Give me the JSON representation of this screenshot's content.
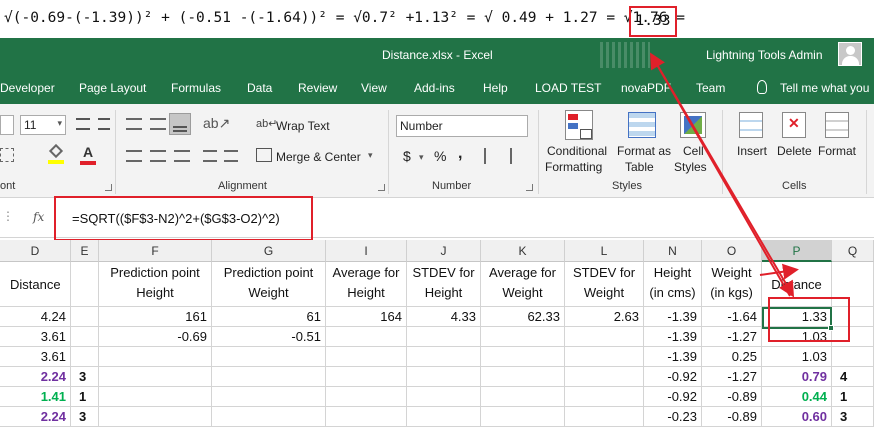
{
  "banner": {
    "expression": "√(-0.69-(-1.39))² + (-0.51 -(-1.64))² = √0.7² +1.13² = √ 0.49 + 1.27 = √1.76 = ",
    "result": "1.33"
  },
  "titlebar": {
    "document": "Distance.xlsx  -  Excel",
    "user": "Lightning Tools Admin"
  },
  "menu": {
    "tabs": [
      "Developer",
      "Page Layout",
      "Formulas",
      "Data",
      "Review",
      "View",
      "Add-ins",
      "Help",
      "LOAD TEST",
      "novaPDF",
      "Team"
    ],
    "tell_me": "Tell me what you"
  },
  "ribbon": {
    "font_size": "11",
    "font_group_label": "ont",
    "wrap_text": "Wrap Text",
    "merge_center": "Merge & Center",
    "alignment_label": "Alignment",
    "number_format": "Number",
    "number_label": "Number",
    "currency_symbol": "$",
    "percent_symbol": "%",
    "comma_symbol": ",",
    "conditional_formatting": [
      "Conditional",
      "Formatting"
    ],
    "format_as_table": [
      "Format as",
      "Table"
    ],
    "cell_styles": [
      "Cell",
      "Styles"
    ],
    "styles_label": "Styles",
    "insert": "Insert",
    "delete": "Delete",
    "format": "Format",
    "cells_label": "Cells"
  },
  "formula_bar": {
    "fx": "fx",
    "formula": "=SQRT(($F$3-N2)^2+($G$3-O2)^2)"
  },
  "columns": [
    "D",
    "E",
    "F",
    "G",
    "I",
    "J",
    "K",
    "L",
    "N",
    "O",
    "P",
    "Q"
  ],
  "header_row": {
    "D": "Distance",
    "F": [
      "Prediction point",
      "Height"
    ],
    "G": [
      "Prediction point",
      "Weight"
    ],
    "I": [
      "Average for",
      "Height"
    ],
    "J": [
      "STDEV for",
      "Height"
    ],
    "K": [
      "Average for",
      "Weight"
    ],
    "L": [
      "STDEV for",
      "Weight"
    ],
    "N": [
      "Height",
      "(in cms)"
    ],
    "O": [
      "Weight",
      "(in kgs)"
    ],
    "P": "Distance"
  },
  "rows": [
    {
      "D": "4.24",
      "E": "",
      "F": "161",
      "G": "61",
      "I": "164",
      "J": "4.33",
      "K": "62.33",
      "L": "2.63",
      "N": "-1.39",
      "O": "-1.64",
      "P": "1.33",
      "Q": ""
    },
    {
      "D": "3.61",
      "E": "",
      "F": "-0.69",
      "G": "-0.51",
      "I": "",
      "J": "",
      "K": "",
      "L": "",
      "N": "-1.39",
      "O": "-1.27",
      "P": "1.03",
      "Q": ""
    },
    {
      "D": "3.61",
      "E": "",
      "F": "",
      "G": "",
      "I": "",
      "J": "",
      "K": "",
      "L": "",
      "N": "-1.39",
      "O": "0.25",
      "P": "1.03",
      "Q": ""
    },
    {
      "D": "2.24",
      "E": "3",
      "F": "",
      "G": "",
      "I": "",
      "J": "",
      "K": "",
      "L": "",
      "N": "-0.92",
      "O": "-1.27",
      "P": "0.79",
      "Q": "4"
    },
    {
      "D": "1.41",
      "E": "1",
      "F": "",
      "G": "",
      "I": "",
      "J": "",
      "K": "",
      "L": "",
      "N": "-0.92",
      "O": "-0.89",
      "P": "0.44",
      "Q": "1"
    },
    {
      "D": "2.24",
      "E": "3",
      "F": "",
      "G": "",
      "I": "",
      "J": "",
      "K": "",
      "L": "",
      "N": "-0.23",
      "O": "-0.89",
      "P": "0.60",
      "Q": "3"
    }
  ],
  "colors": {
    "excel_green": "#217346",
    "annotation_red": "#e0202a",
    "purple": "#7030a0",
    "green": "#00b050"
  }
}
